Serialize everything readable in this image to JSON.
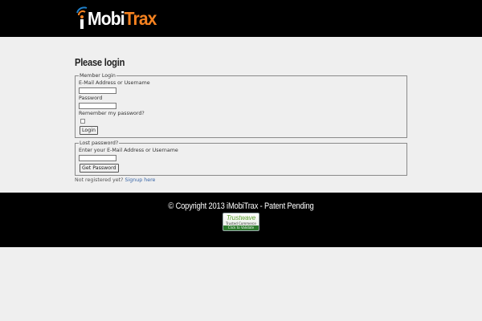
{
  "header": {
    "logo_prefix": "i",
    "logo_mobi": "Mobi",
    "logo_trax": "Trax",
    "brand_colors": {
      "white": "#ffffff",
      "orange": "#f58220",
      "blue": "#1e7fc8"
    }
  },
  "page": {
    "title": "Please login"
  },
  "member_login": {
    "legend": "Member Login",
    "email_label": "E-Mail Address or Username",
    "email_value": "",
    "password_label": "Password",
    "password_value": "",
    "remember_label": "Remember my password?",
    "remember_checked": false,
    "login_button": "Login"
  },
  "lost_password": {
    "legend": "Lost password?",
    "email_label": "Enter your E-Mail Address or Username",
    "email_value": "",
    "submit_button": "Get Password"
  },
  "register": {
    "prefix": "Not registered yet?",
    "link": "Signup here"
  },
  "footer": {
    "copyright": "© Copyright 2013 iMobiTrax - Patent Pending",
    "trust_badge": {
      "name": "Trustwave",
      "subtitle": "Trusted Commerce",
      "action": "Click to Validate"
    }
  }
}
